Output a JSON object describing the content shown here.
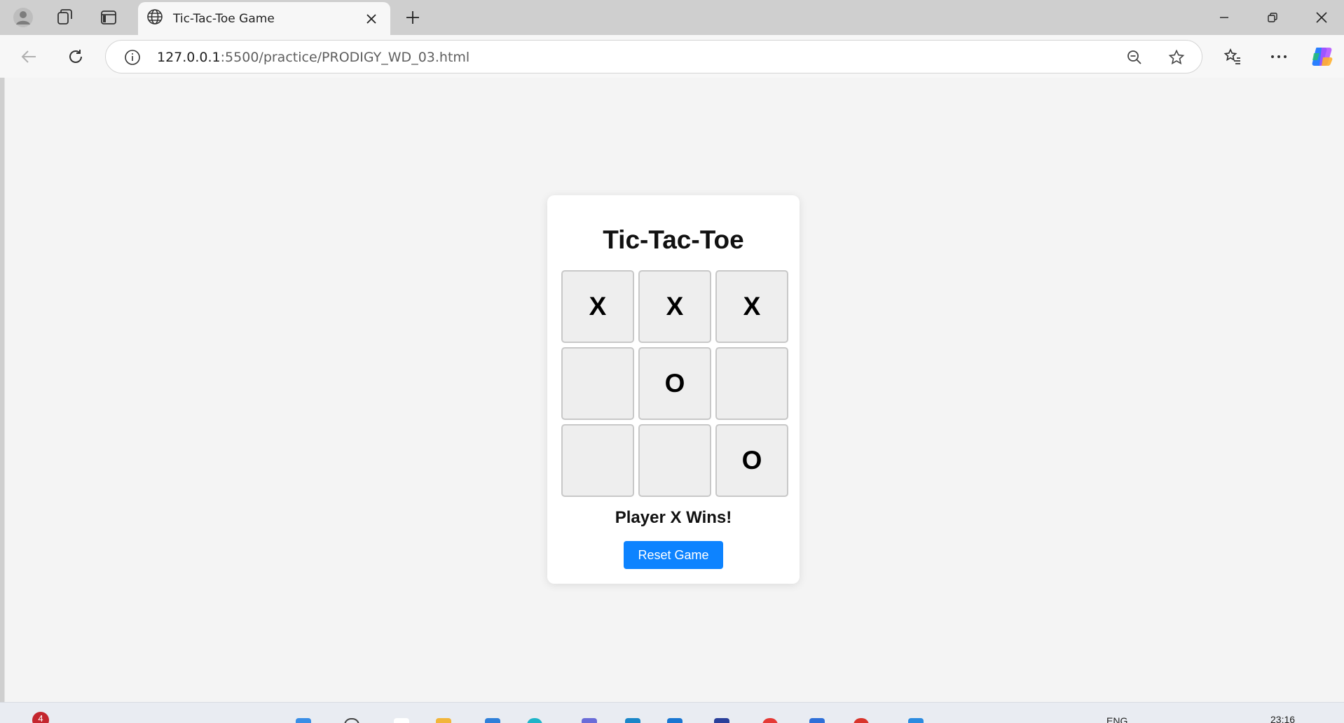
{
  "browser": {
    "tab_title": "Tic-Tac-Toe Game",
    "url_host": "127.0.0.1",
    "url_path": ":5500/practice/PRODIGY_WD_03.html"
  },
  "icons": {
    "profile": "profile-icon",
    "workspaces": "workspaces-icon",
    "vertical_tabs": "vertical-tabs-icon",
    "tab_favicon": "globe-icon",
    "tab_close": "close-icon",
    "new_tab": "plus-icon",
    "minimize": "minimize-icon",
    "restore": "restore-icon",
    "close_window": "close-icon",
    "back": "back-arrow-icon",
    "refresh": "refresh-icon",
    "site_info": "info-icon",
    "zoom": "zoom-out-icon",
    "favorite": "star-icon",
    "favorites": "favorites-icon",
    "more": "more-icon",
    "copilot": "copilot-icon"
  },
  "game": {
    "title": "Tic-Tac-Toe",
    "cells": [
      "X",
      "X",
      "X",
      "",
      "O",
      "",
      "",
      "",
      "O"
    ],
    "status": "Player X Wins!",
    "reset_label": "Reset Game"
  },
  "taskbar": {
    "notification_count": "4",
    "language": "ENG",
    "time": "23:16"
  },
  "colors": {
    "button_bg": "#0d83ff",
    "page_bg": "#f4f4f4",
    "card_bg": "#ffffff",
    "cell_bg": "#eeeeee"
  }
}
